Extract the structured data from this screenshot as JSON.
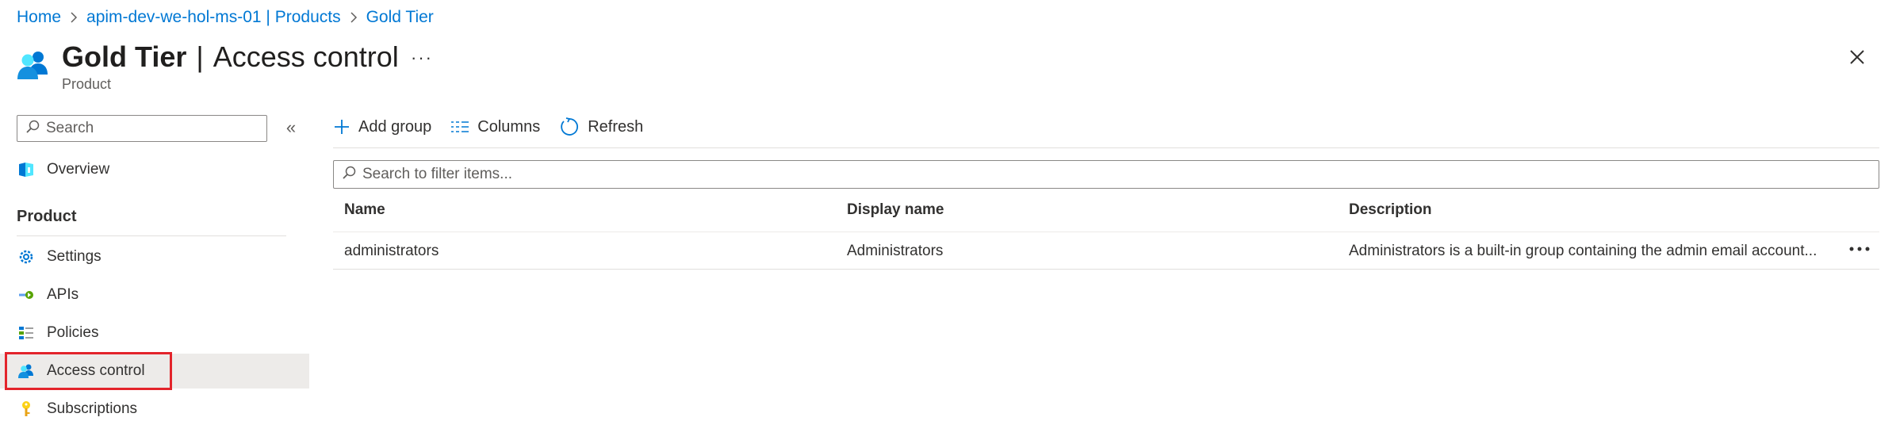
{
  "breadcrumb": {
    "items": [
      {
        "label": "Home"
      },
      {
        "label": "apim-dev-we-hol-ms-01 | Products"
      },
      {
        "label": "Gold Tier"
      }
    ]
  },
  "header": {
    "title_bold": "Gold Tier",
    "title_sep": "|",
    "title_rest": "Access control",
    "more": "···",
    "subtitle": "Product",
    "icon": "users-icon",
    "close_icon": "close-icon"
  },
  "sidebar": {
    "search_placeholder": "Search",
    "collapse": "«",
    "overview": {
      "label": "Overview",
      "icon": "overview-icon"
    },
    "section_header": "Product",
    "items": [
      {
        "label": "Settings",
        "icon": "gear-icon"
      },
      {
        "label": "APIs",
        "icon": "api-icon"
      },
      {
        "label": "Policies",
        "icon": "policies-icon"
      },
      {
        "label": "Access control",
        "icon": "users-icon",
        "selected": true
      },
      {
        "label": "Subscriptions",
        "icon": "key-icon"
      }
    ]
  },
  "toolbar": {
    "add_group": "Add group",
    "columns": "Columns",
    "refresh": "Refresh"
  },
  "filter": {
    "placeholder": "Search to filter items..."
  },
  "table": {
    "columns": [
      "Name",
      "Display name",
      "Description"
    ],
    "rows": [
      {
        "name": "administrators",
        "display_name": "Administrators",
        "description": "Administrators is a built-in group containing the admin email account..."
      }
    ]
  },
  "colors": {
    "accent": "#0078d4",
    "selected_bg": "#edebe9",
    "highlight": "#e3242b"
  }
}
